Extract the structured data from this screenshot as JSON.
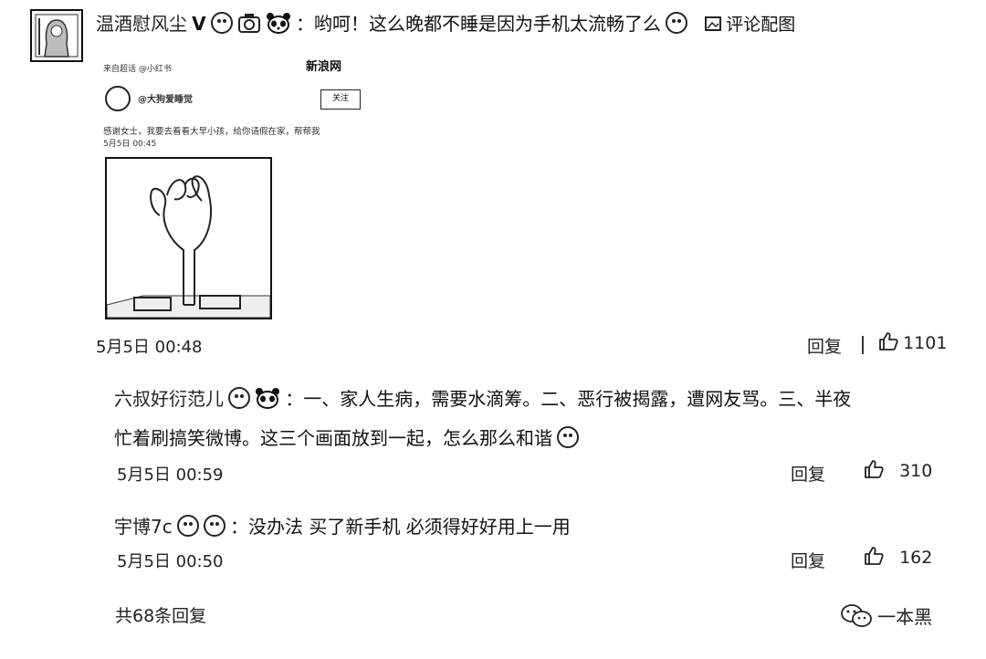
{
  "comment": {
    "author": "温酒慰风尘",
    "text": "：哟呵！这么晚都不睡是因为手机太流畅了么",
    "image_comment_label": "评论配图",
    "time": "5月5日 00:48",
    "reply_label": "回复",
    "likes": "1101"
  },
  "embedded_post": {
    "header_left": "来自超话  @小红书",
    "header_right": "新浪网",
    "user": "@大狗爱睡觉",
    "follow_label": "关注",
    "body": "感谢女士，我要去看看大早小孩，给你请假在家，帮帮我",
    "meta": "5月5日 00:45"
  },
  "replies": [
    {
      "author": "六叔好衍范儿",
      "text_line1": "：一、家人生病，需要水滴筹。二、恶行被揭露，遭网友骂。三、半夜",
      "text_line2": "忙着刷搞笑微博。这三个画面放到一起，怎么那么和谐",
      "time": "5月5日 00:59",
      "reply_label": "回复",
      "likes": "310"
    },
    {
      "author": "宇博7c",
      "text": "：没办法 买了新手机 必须得好好用上一用",
      "time": "5月5日 00:50",
      "reply_label": "回复",
      "likes": "162"
    }
  ],
  "footer": {
    "total": "共68条回复",
    "watermark": "一本黑"
  },
  "icons": [
    "avatar-icon",
    "verified-v-icon",
    "emoji-icon",
    "camera-icon",
    "panda-icon",
    "image-icon",
    "thumb-up-icon",
    "wechat-icon"
  ]
}
